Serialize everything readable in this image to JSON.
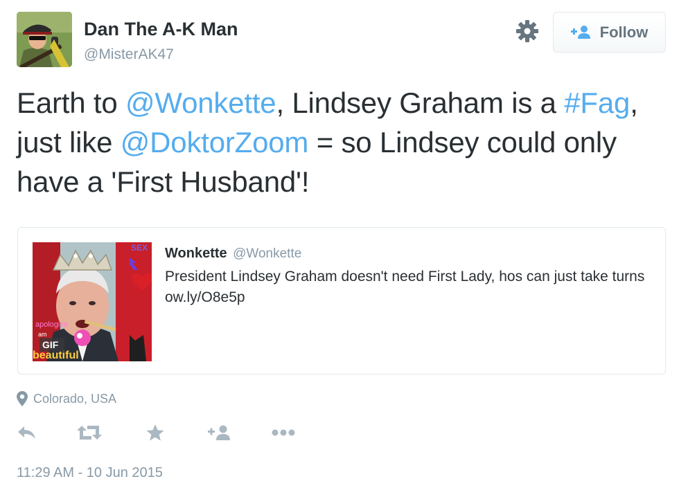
{
  "user": {
    "display_name": "Dan The A-K Man",
    "screen_name": "@MisterAK47",
    "avatar_icon": "avatar-soldier-image"
  },
  "header_actions": {
    "settings_icon": "gear-icon",
    "follow_label": "Follow",
    "follow_icon": "add-user-icon"
  },
  "tweet": {
    "segments": [
      {
        "text": "Earth to ",
        "link": false
      },
      {
        "text": "@Wonkette",
        "link": true
      },
      {
        "text": ", Lindsey Graham is a ",
        "link": false
      },
      {
        "text": "#Fag",
        "link": true
      },
      {
        "text": ", just like ",
        "link": false
      },
      {
        "text": "@DoktorZoom",
        "link": true
      },
      {
        "text": " = so Lindsey could only have a 'First Husband'!",
        "link": false
      }
    ]
  },
  "quoted_tweet": {
    "name": "Wonkette",
    "handle": "@Wonkette",
    "text": "President Lindsey Graham doesn't need First Lady, hos can just take turns  ow.ly/O8e5p",
    "media": {
      "overlay_texts": [
        "SEX",
        "apologize",
        "am",
        "beautiful",
        "GIF"
      ]
    }
  },
  "location": {
    "icon": "location-pin-icon",
    "text": "Colorado, USA"
  },
  "actions": [
    {
      "name": "reply",
      "icon": "reply-icon"
    },
    {
      "name": "retweet",
      "icon": "retweet-icon"
    },
    {
      "name": "favorite",
      "icon": "star-icon"
    },
    {
      "name": "follow",
      "icon": "add-user-icon"
    },
    {
      "name": "more",
      "icon": "more-icon"
    }
  ],
  "timestamp": "11:29 AM - 10 Jun 2015",
  "colors": {
    "link": "#55acee",
    "text": "#292f33",
    "muted": "#8899a6",
    "icon": "#aab8c2",
    "border": "#e1e8ed"
  }
}
